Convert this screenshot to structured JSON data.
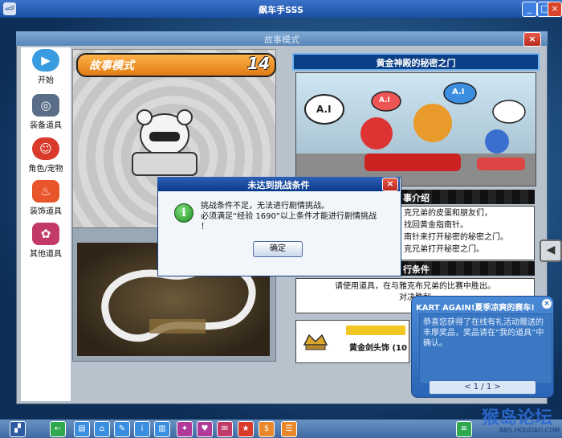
{
  "window": {
    "title": "飙车手SSS"
  },
  "panel": {
    "title": "故事模式"
  },
  "nav": [
    {
      "label": "开始",
      "color": "#3a9ce0"
    },
    {
      "label": "装备道具",
      "color": "#5a6e8a"
    },
    {
      "label": "角色/宠物",
      "color": "#d93a2a"
    },
    {
      "label": "装饰道具",
      "color": "#e8552a"
    },
    {
      "label": "其他道具",
      "color": "#c23a6a"
    }
  ],
  "story": {
    "banner": "故事模式",
    "level": "14"
  },
  "right": {
    "title": "黄金神殿的秘密之门",
    "bubbles": [
      "A.I",
      "A.I",
      "A.I"
    ],
    "intro_title": "事介绍",
    "intro_lines": [
      "克兄弟的皮蛋和朋友们，",
      "找回黄金指南针。",
      "南针来打开秘密的秘密之门。",
      "克兄弟打开秘密之门。"
    ],
    "cond_title": "行条件",
    "cond_lines": [
      "请使用道具，在与雅克布兄弟的比赛中胜出。",
      "对决胜利"
    ],
    "reward_label": "黄金剑头饰 (10"
  },
  "modal": {
    "title": "未达到挑战条件",
    "icon": "info-icon",
    "line1": "挑战条件不足，无法进行剧情挑战。",
    "line2": "必须满足“经验 1690”以上条件才能进行剧情挑战",
    "line3": "！",
    "ok": "确定"
  },
  "popup": {
    "title": "KART AGAIN!夏季凉爽的赛车!",
    "body": "恭喜您获得了在线有礼活动赠送的丰厚奖品，奖品请在“我的道具”中确认。",
    "pager": "< 1 / 1 >"
  },
  "watermark": {
    "main": "猴岛论坛",
    "sub": "BBS.HOUDAO.COM"
  }
}
